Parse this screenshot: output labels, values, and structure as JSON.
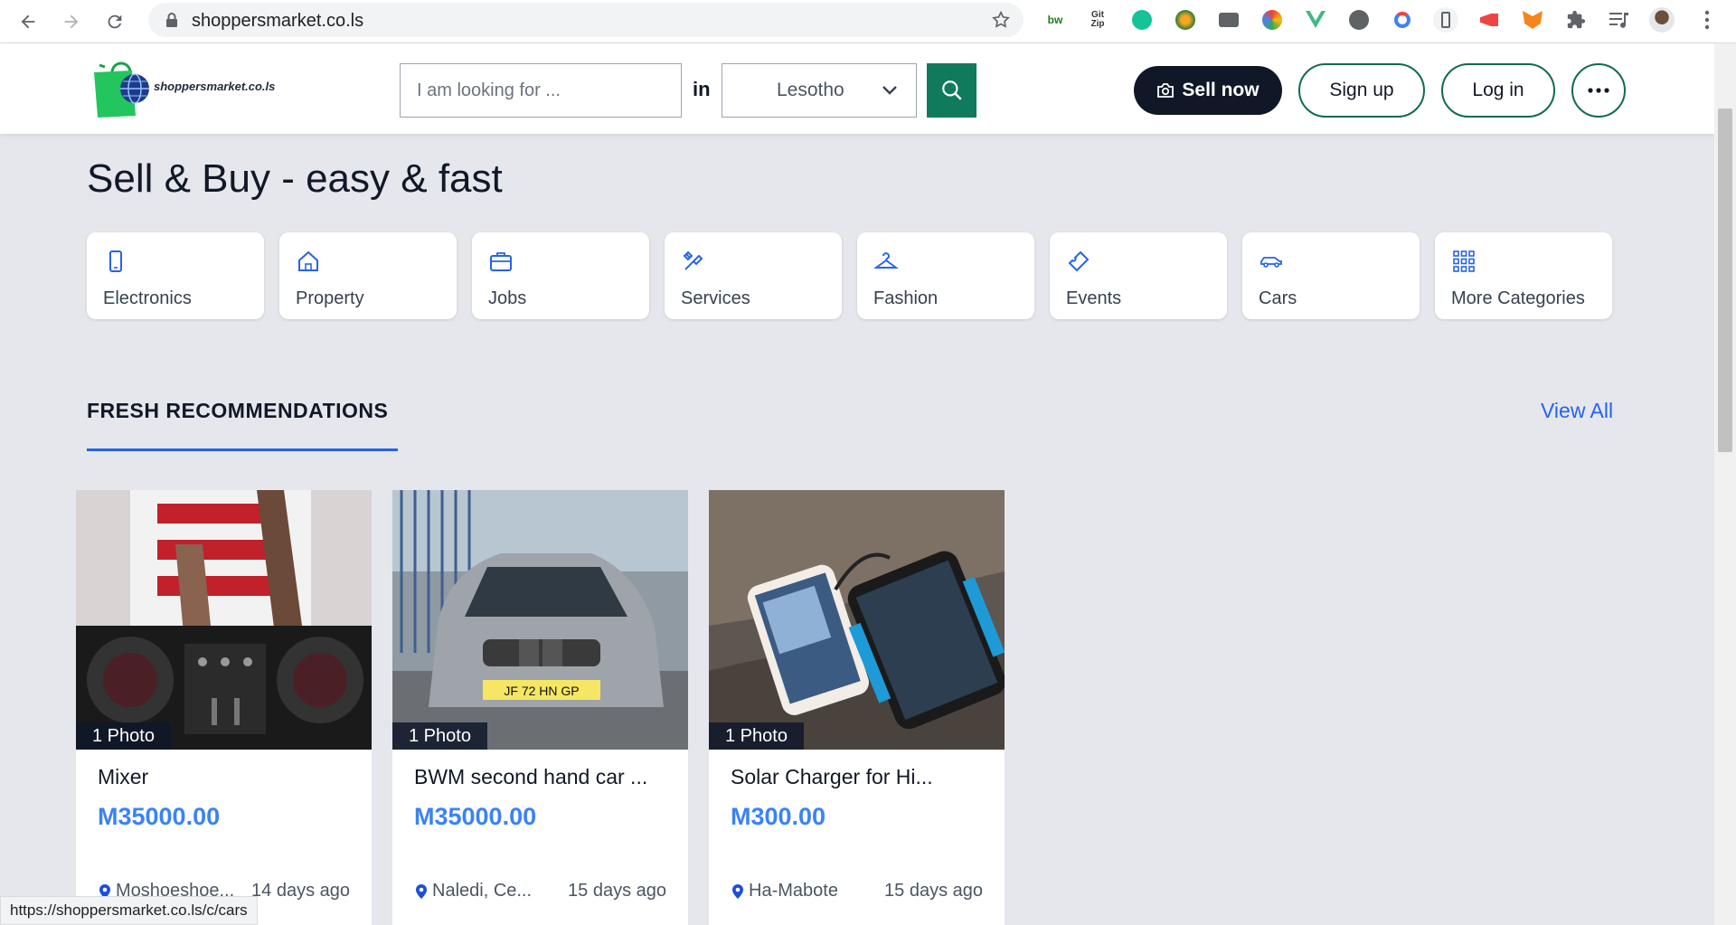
{
  "browser": {
    "url": "shoppersmarket.co.ls",
    "status_url": "https://shoppersmarket.co.ls/c/cars",
    "extensions": [
      "bw",
      "Git Zip",
      "grammarly",
      "globe",
      "media",
      "chrome-logo",
      "vue",
      "arrow",
      "magnet",
      "phone",
      "megaphone",
      "fox",
      "puzzle",
      "playlist",
      "profile"
    ]
  },
  "header": {
    "logo_text": "shoppersmarket.co.ls",
    "search_placeholder": "I am looking for ...",
    "in_label": "in",
    "country": "Lesotho",
    "sell_label": "Sell now",
    "signup_label": "Sign up",
    "login_label": "Log in"
  },
  "hero": {
    "title": "Sell & Buy - easy & fast"
  },
  "categories": [
    {
      "label": "Electronics",
      "icon": "phone-icon"
    },
    {
      "label": "Property",
      "icon": "house-icon"
    },
    {
      "label": "Jobs",
      "icon": "briefcase-icon"
    },
    {
      "label": "Services",
      "icon": "tools-icon"
    },
    {
      "label": "Fashion",
      "icon": "hanger-icon"
    },
    {
      "label": "Events",
      "icon": "ticket-icon"
    },
    {
      "label": "Cars",
      "icon": "car-icon"
    },
    {
      "label": "More Categories",
      "icon": "grid-icon"
    }
  ],
  "recommendations": {
    "title": "FRESH RECOMMENDATIONS",
    "view_all": "View All",
    "items": [
      {
        "photos": "1 Photo",
        "title": "Mixer",
        "price": "M35000.00",
        "location": "Moshoeshoe...",
        "age": "14 days ago"
      },
      {
        "photos": "1 Photo",
        "title": "BWM second hand car ...",
        "price": "M35000.00",
        "location": "Naledi, Ce...",
        "age": "15 days ago"
      },
      {
        "photos": "1 Photo",
        "title": "Solar Charger for Hi...",
        "price": "M300.00",
        "location": "Ha-Mabote",
        "age": "15 days ago"
      }
    ]
  },
  "colors": {
    "primary_green": "#0f7a5c",
    "accent_blue": "#2563eb",
    "price_blue": "#3b82f6",
    "dark": "#101828"
  }
}
